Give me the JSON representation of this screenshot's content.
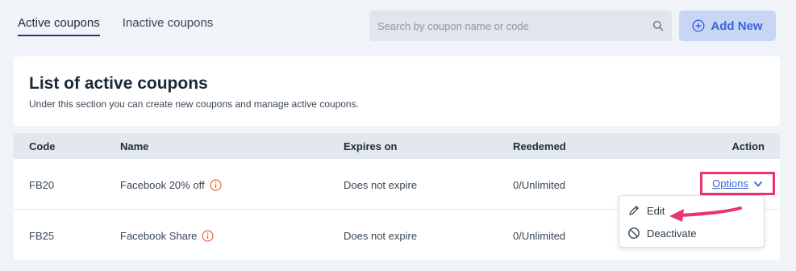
{
  "tabs": [
    {
      "label": "Active coupons",
      "active": true
    },
    {
      "label": "Inactive coupons",
      "active": false
    }
  ],
  "search": {
    "placeholder": "Search by coupon name or code",
    "icon": "search-icon"
  },
  "add_button": {
    "label": "Add New",
    "icon": "plus-circle-icon"
  },
  "header": {
    "title": "List of active coupons",
    "subtitle": "Under this section you can create new coupons and manage active coupons."
  },
  "table": {
    "columns": [
      "Code",
      "Name",
      "Expires on",
      "Reedemed",
      "Action"
    ],
    "rows": [
      {
        "code": "FB20",
        "name": "Facebook 20% off",
        "expires": "Does not expire",
        "redeemed": "0/Unlimited",
        "action": "Options"
      },
      {
        "code": "FB25",
        "name": "Facebook Share",
        "expires": "Does not expire",
        "redeemed": "0/Unlimited",
        "action": ""
      }
    ]
  },
  "menu": {
    "items": [
      {
        "label": "Edit",
        "icon": "pencil-icon"
      },
      {
        "label": "Deactivate",
        "icon": "ban-icon"
      }
    ]
  },
  "colors": {
    "accent": "#3a64d8",
    "highlight": "#e8356e",
    "info": "#e8653a",
    "background": "#f0f3f8"
  }
}
